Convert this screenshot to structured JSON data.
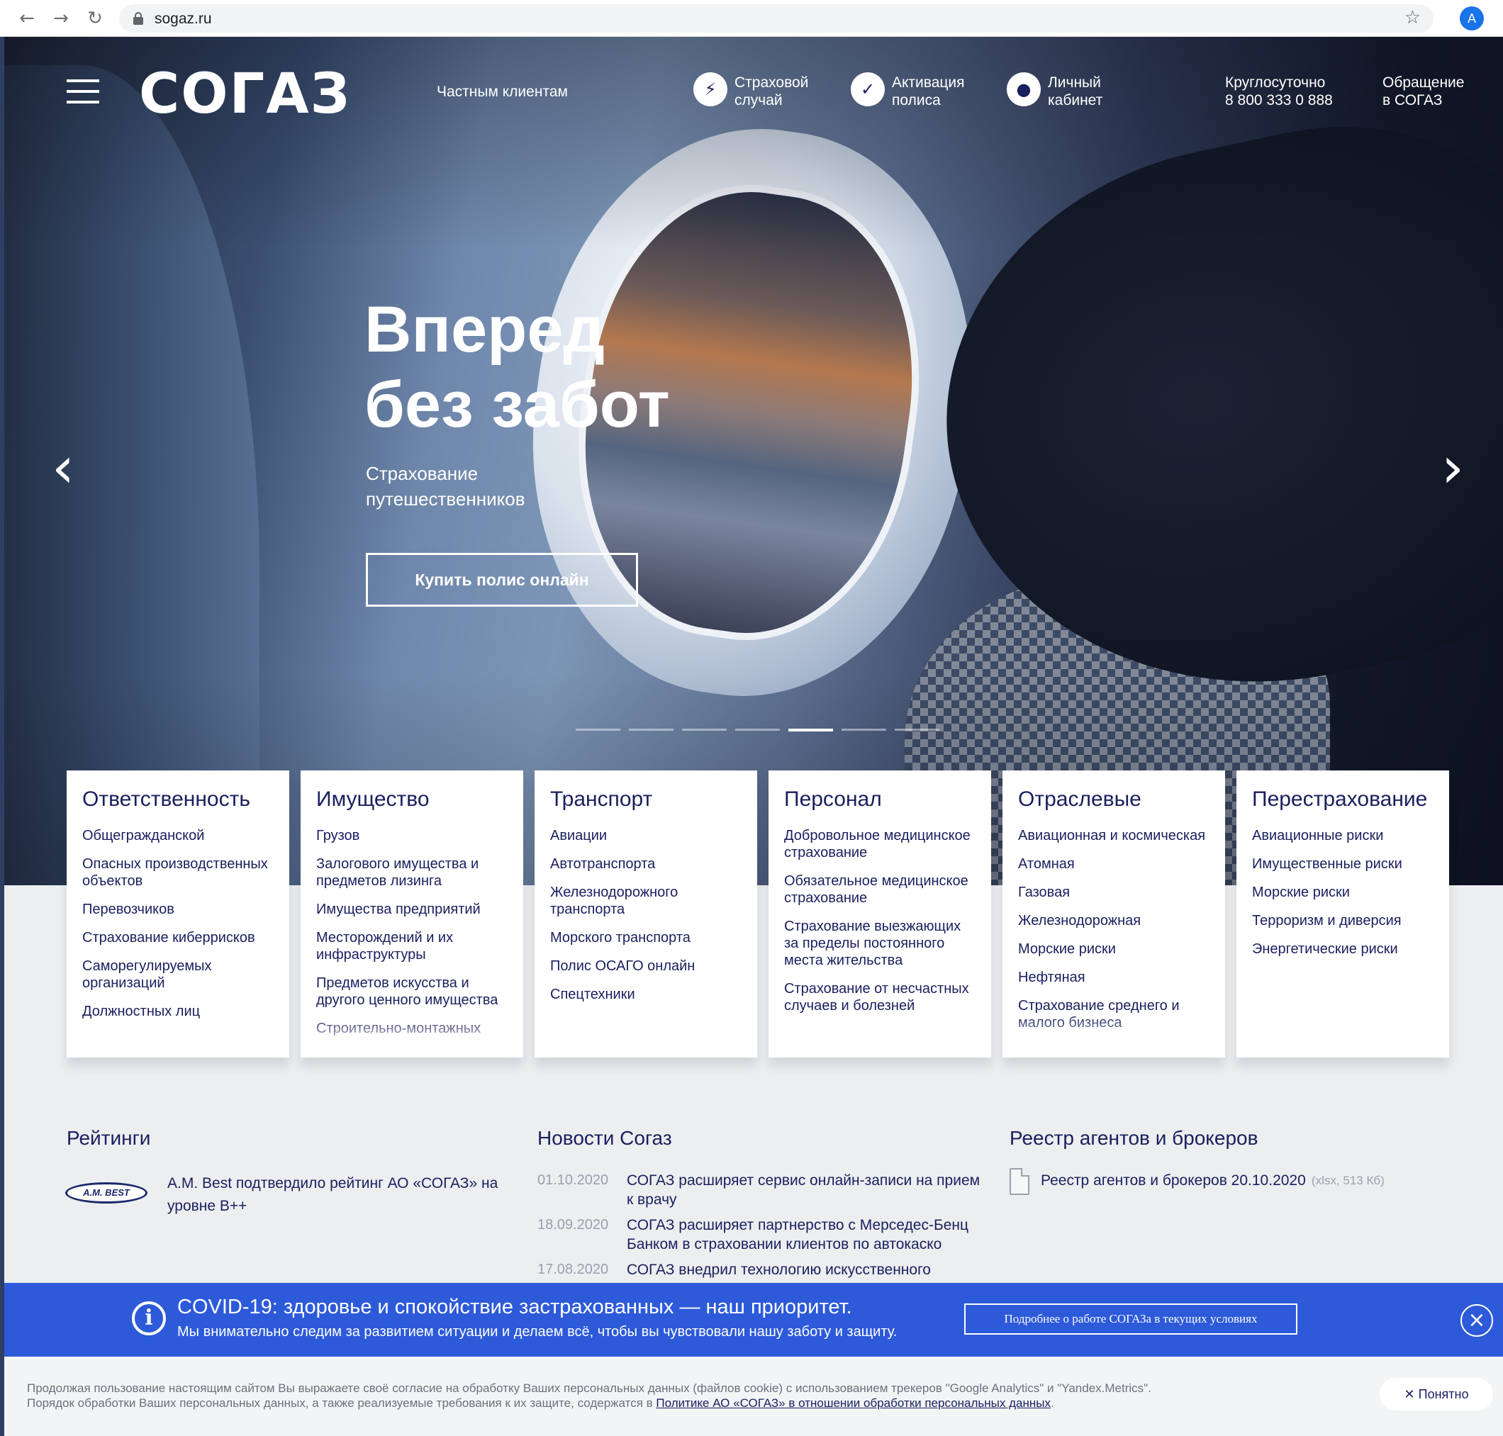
{
  "browser": {
    "url": "sogaz.ru",
    "back_icon": "←",
    "forward_icon": "→",
    "reload_icon": "↻",
    "star_icon": "☆",
    "profile_initial": "A"
  },
  "header": {
    "logo": "СОГАЗ",
    "private_clients": "Частным клиентам",
    "insured_event_line1": "Страховой",
    "insured_event_line2": "случай",
    "policy_activation_line1": "Активация",
    "policy_activation_line2": "полиса",
    "account_line1": "Личный",
    "account_line2": "кабинет",
    "phone_line1": "Круглосуточно",
    "phone_line2": "8 800 333 0 888",
    "appeal_line1": "Обращение",
    "appeal_line2": "в СОГАЗ"
  },
  "hero": {
    "title_line1": "Вперед",
    "title_line2": "без забот",
    "subtitle": "Страхование путешественников",
    "cta": "Купить полис онлайн",
    "prev_arrow": "‹",
    "next_arrow": "›",
    "slide_count": 7,
    "active_slide": 5
  },
  "categories": [
    {
      "title": "Ответственность",
      "items": [
        "Общегражданской",
        "Опасных производственных объектов",
        "Перевозчиков",
        "Страхование киберрисков",
        "Саморегулируемых организаций",
        "Должностных лиц"
      ]
    },
    {
      "title": "Имущество",
      "items": [
        "Грузов",
        "Залогового имущества и предметов лизинга",
        "Имущества предприятий",
        "Месторождений и их инфраструктуры",
        "Предметов искусства и другого ценного имущества",
        "Строительно-монтажных"
      ]
    },
    {
      "title": "Транспорт",
      "items": [
        "Авиации",
        "Автотранспорта",
        "Железнодорожного транспорта",
        "Морского транспорта",
        "Полис ОСАГО онлайн",
        "Спецтехники"
      ]
    },
    {
      "title": "Персонал",
      "items": [
        "Добровольное медицинское страхование",
        "Обязательное медицинское страхование",
        "Страхование выезжающих за пределы постоянного места жительства",
        "Страхование от несчастных случаев и болезней"
      ]
    },
    {
      "title": "Отраслевые",
      "items": [
        "Авиационная и космическая",
        "Атомная",
        "Газовая",
        "Железнодорожная",
        "Морские риски",
        "Нефтяная",
        "Страхование среднего и малого бизнеса"
      ]
    },
    {
      "title": "Перестрахование",
      "items": [
        "Авиационные риски",
        "Имущественные риски",
        "Морские риски",
        "Терроризм и диверсия",
        "Энергетические риски"
      ]
    }
  ],
  "ratings": {
    "title": "Рейтинги",
    "logo_text": "A.M. BEST",
    "text": "A.M. Best подтвердило рейтинг АО «СОГАЗ» на уровне B++"
  },
  "news": {
    "title": "Новости Согаз",
    "items": [
      {
        "date": "01.10.2020",
        "text": "СОГАЗ расширяет сервис онлайн-записи на прием к врачу"
      },
      {
        "date": "18.09.2020",
        "text": "СОГАЗ расширяет партнерство с Мерседес-Бенц Банком в страховании клиентов по автокаско"
      },
      {
        "date": "17.08.2020",
        "text": "СОГАЗ внедрил технологию искусственного"
      }
    ]
  },
  "registry": {
    "title": "Реестр агентов и брокеров",
    "link": "Реестр агентов и брокеров 20.10.2020",
    "meta": "(xlsx, 513 Кб)"
  },
  "covid": {
    "title": "COVID-19: здоровье и спокойствие застрахованных — наш приоритет.",
    "subtitle": "Мы внимательно следим за развитием ситуации и делаем всё, чтобы вы чувствовали нашу заботу и защиту.",
    "button": "Подробнее о работе СОГАЗа в текущих условиях",
    "info_icon": "i",
    "close_icon": "×"
  },
  "cookie": {
    "text_line1": "Продолжая пользование настоящим сайтом Вы выражаете своё согласие на обработку Ваших персональных данных (файлов cookie) с использованием трекеров \"Google Analytics\" и \"Yandex.Metrics\".",
    "text_line2_prefix": "Порядок обработки Ваших персональных данных, а также реализуемые требования к их защите, содержатся в ",
    "link": "Политике АО «СОГАЗ» в отношении обработки персональных данных",
    "text_line2_suffix": ".",
    "button": "Понятно",
    "button_icon": "✕"
  }
}
